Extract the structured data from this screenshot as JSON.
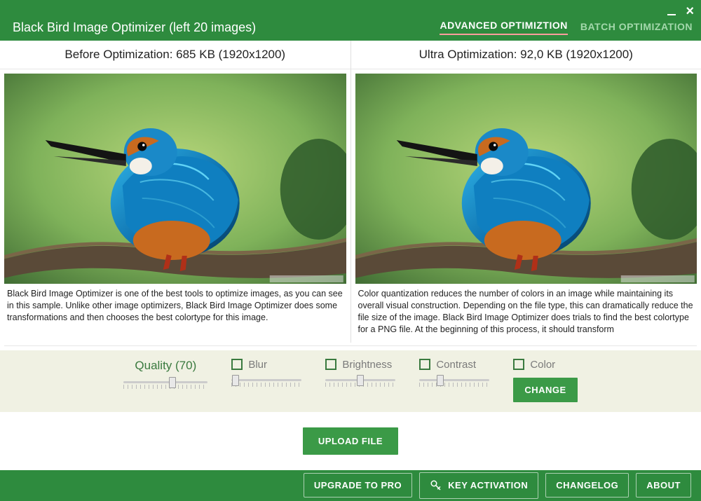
{
  "window": {
    "title": "Black Bird Image Optimizer (left 20 images)",
    "tabs": {
      "advanced": "ADVANCED OPTIMIZTION",
      "batch": "BATCH OPTIMIZATION"
    }
  },
  "panels": {
    "before": {
      "title": "Before Optimization: 685 KB (1920x1200)",
      "description": "Black Bird Image Optimizer is one of the best tools to optimize images, as you can see in this sample. Unlike other image optimizers, Black Bird Image Optimizer does some transformations and then chooses the best colortype for this image."
    },
    "after": {
      "title": "Ultra Optimization: 92,0 KB (1920x1200)",
      "description": "Color quantization reduces the number of colors in an image while maintaining its overall visual construction. Depending on the file type, this can dramatically reduce the file size of the image. Black Bird Image Optimizer does trials to find the best colortype for a PNG file. At the beginning of this process, it should transform"
    }
  },
  "controls": {
    "quality": {
      "label": "Quality (70)",
      "value": 70
    },
    "blur": {
      "label": "Blur",
      "checked": false,
      "value": 5
    },
    "brightness": {
      "label": "Brightness",
      "checked": false,
      "value": 50
    },
    "contrast": {
      "label": "Contrast",
      "checked": false,
      "value": 30
    },
    "color": {
      "label": "Color",
      "checked": false
    },
    "change_button": "CHANGE"
  },
  "actions": {
    "upload": "UPLOAD FILE"
  },
  "footer": {
    "upgrade": "UPGRADE TO PRO",
    "key_activation": "KEY ACTIVATION",
    "changelog": "CHANGELOG",
    "about": "ABOUT"
  }
}
